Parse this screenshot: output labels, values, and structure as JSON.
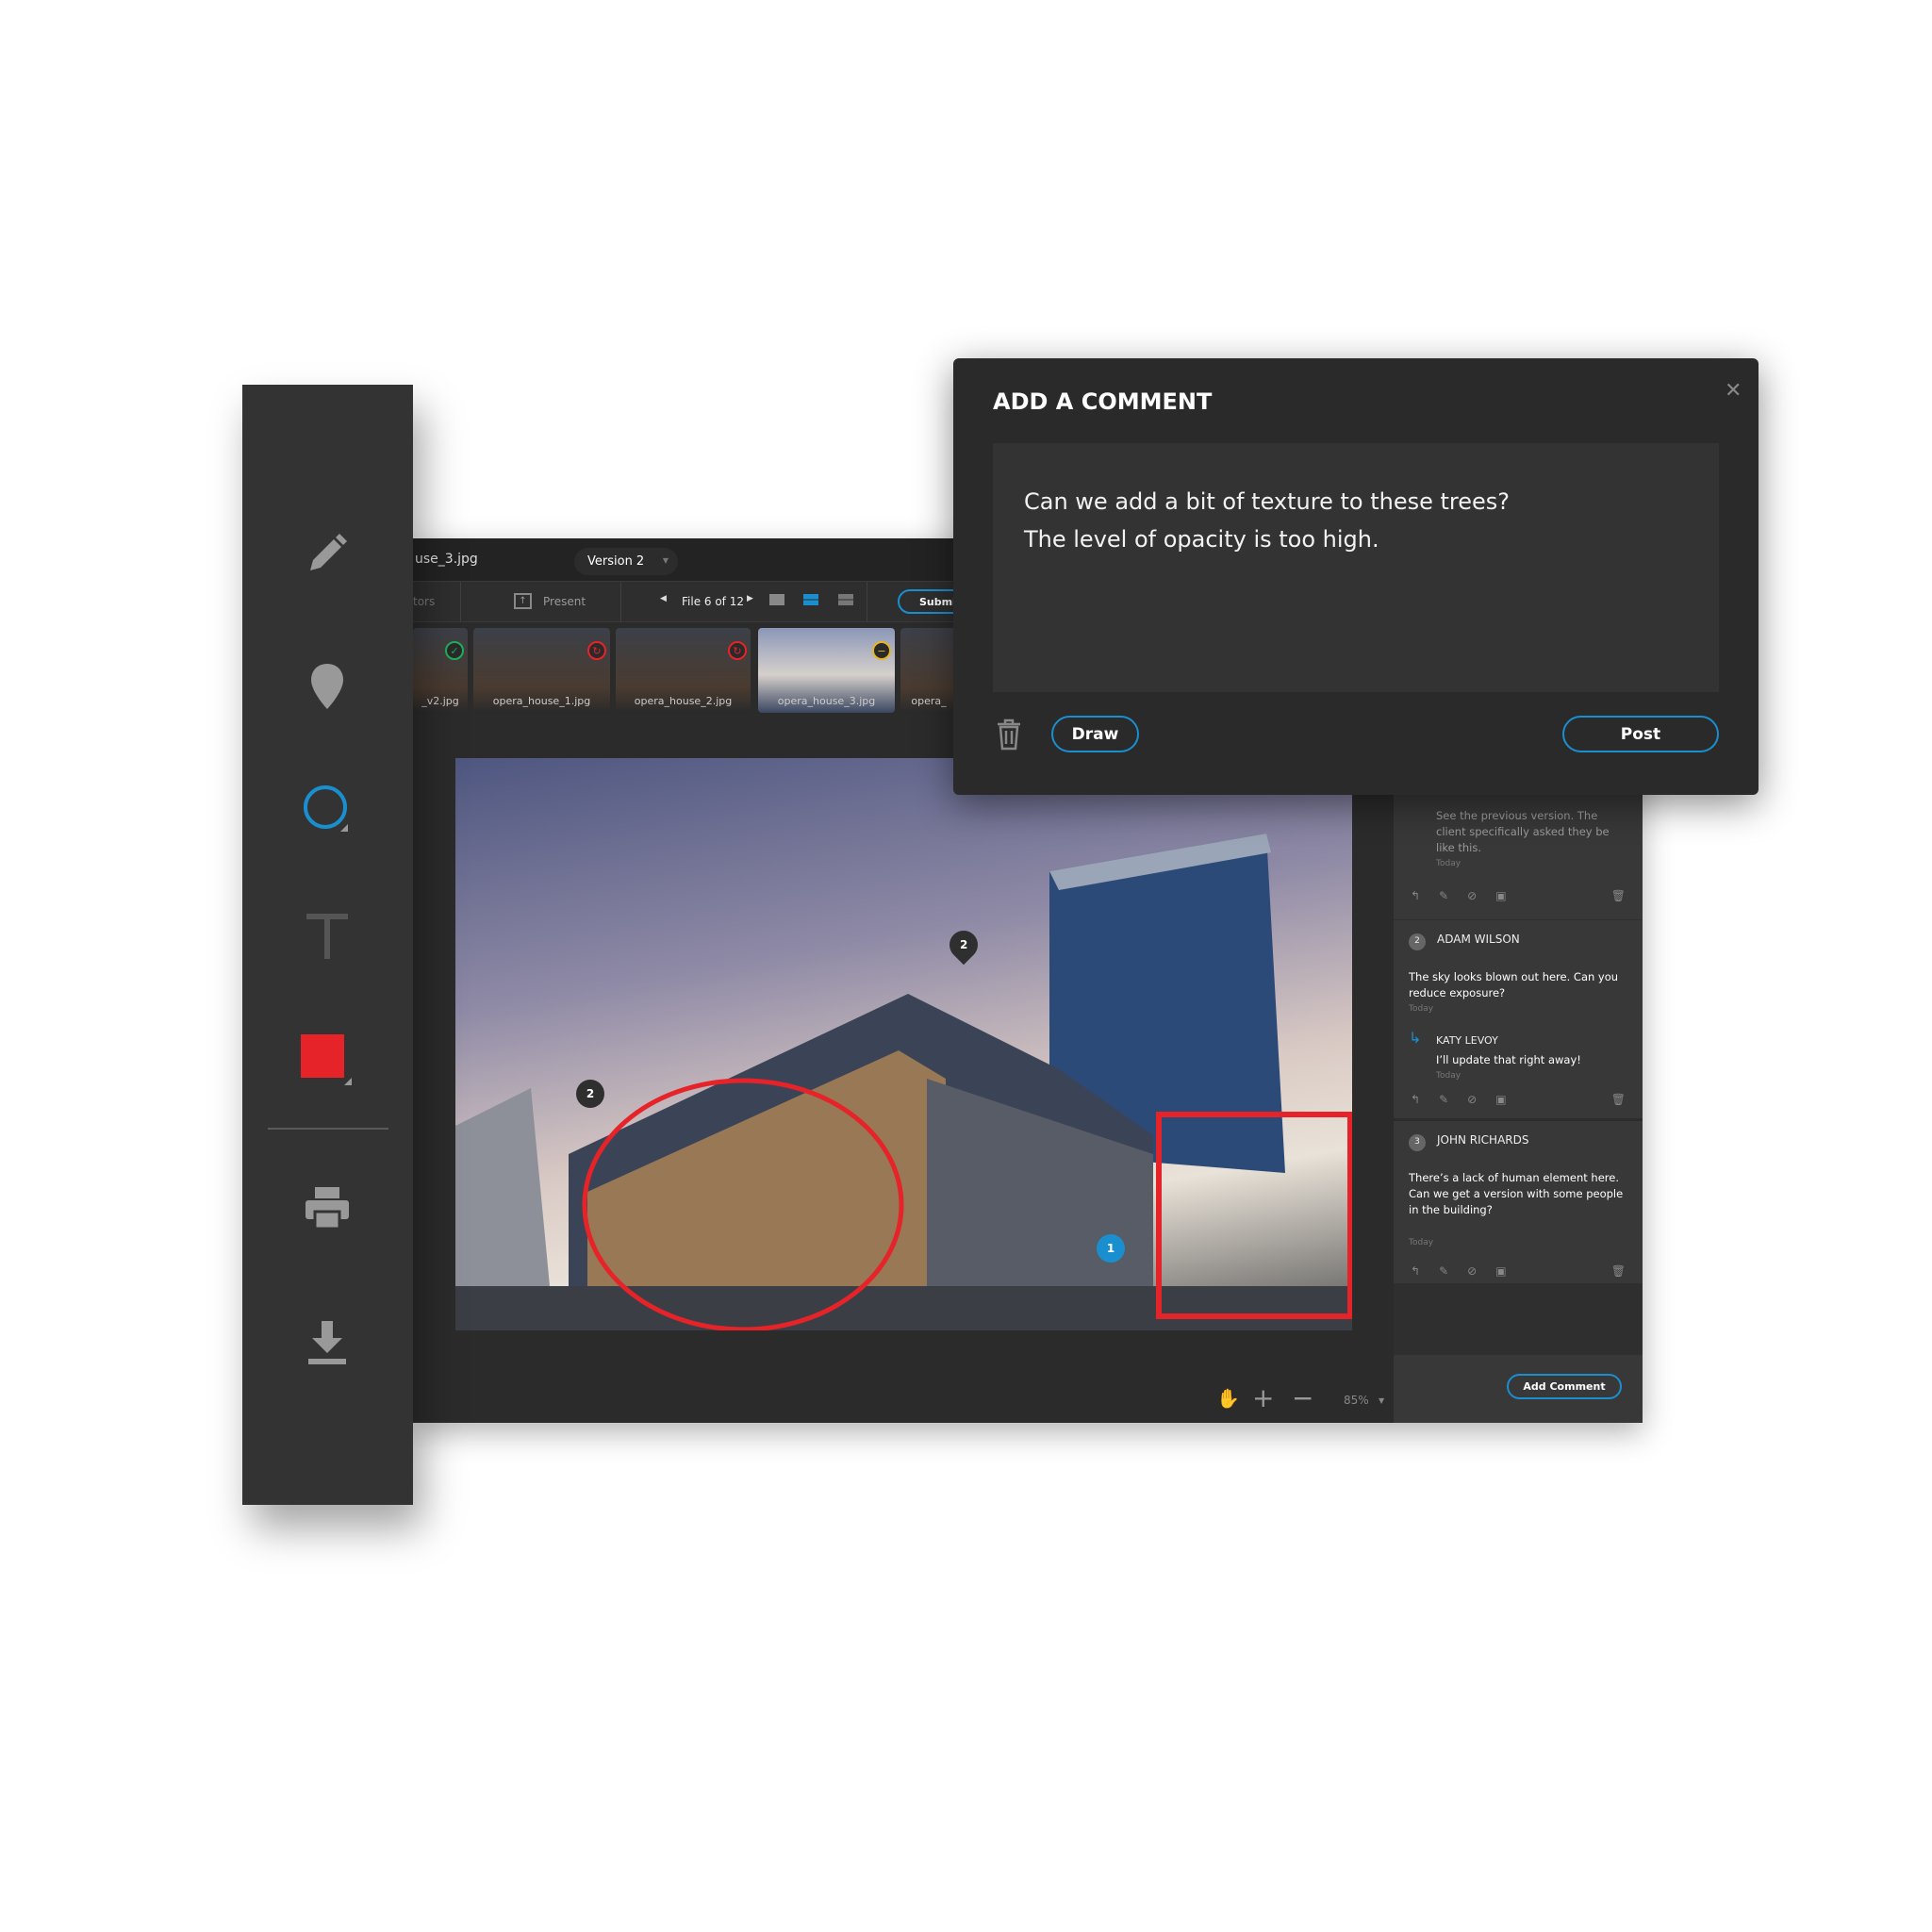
{
  "tools": [
    {
      "icon": "pencil-icon"
    },
    {
      "icon": "map-pin-icon"
    },
    {
      "icon": "circle-icon"
    },
    {
      "icon": "text-icon"
    },
    {
      "icon": "color-swatch-icon",
      "color": "#e52329"
    },
    {
      "icon": "print-icon"
    },
    {
      "icon": "download-icon"
    }
  ],
  "header": {
    "filename": "use_3.jpg",
    "version": "Version 2"
  },
  "toolbar": {
    "collaborators": "tors",
    "present": "Present",
    "file_counter": "File 6 of 12",
    "submit": "Submit"
  },
  "thumbnails": [
    {
      "name": "_v2.jpg",
      "status": "approved",
      "color": "#1fae5b"
    },
    {
      "name": "opera_house_1.jpg",
      "status": "revise",
      "color": "#e52329"
    },
    {
      "name": "opera_house_2.jpg",
      "status": "revise",
      "color": "#e52329"
    },
    {
      "name": "opera_house_3.jpg",
      "status": "pending",
      "color": "#e5b622"
    },
    {
      "name": "opera_",
      "status": "",
      "color": ""
    }
  ],
  "pins": [
    "2",
    "2",
    "1"
  ],
  "zoom": {
    "level": "85%"
  },
  "comments": [
    {
      "text": "See the previous version. The client specifically asked they be like this.",
      "time": "Today"
    },
    {
      "number": "2",
      "author": "ADAM WILSON",
      "text": "The sky looks blown out here. Can you reduce exposure?",
      "time": "Today",
      "reply": {
        "author": "KATY LEVOY",
        "text": "I’ll update that right away!",
        "time": "Today"
      }
    },
    {
      "number": "3",
      "author": "JOHN RICHARDS",
      "text": "There’s a lack of human element here. Can we get a version with some people in the building?",
      "time": "Today"
    }
  ],
  "add_comment": "Add Comment",
  "dialog": {
    "title": "ADD A COMMENT",
    "text_line1": "Can we add a bit of texture to these trees?",
    "text_line2": "The level of opacity is too high.",
    "draw": "Draw",
    "post": "Post"
  },
  "colors": {
    "accent": "#1a8fd0",
    "annotation": "#e52329"
  }
}
